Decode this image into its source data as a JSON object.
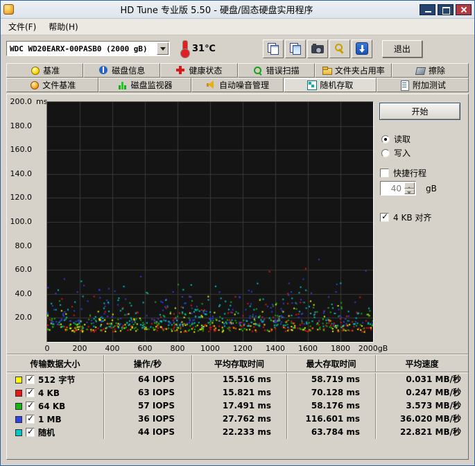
{
  "window": {
    "title": "HD Tune 专业版 5.50 - 硬盘/固态硬盘实用程序"
  },
  "menu": {
    "items": [
      "文件(F)",
      "帮助(H)"
    ]
  },
  "toolbar": {
    "drive": "WDC WD20EARX-00PASB0 (2000 gB)",
    "temperature": "31℃",
    "exit_label": "退出"
  },
  "tabs": {
    "row1": [
      "基准",
      "磁盘信息",
      "健康状态",
      "错误扫描",
      "文件夹占用率",
      "擦除"
    ],
    "row2": [
      "文件基准",
      "磁盘监视器",
      "自动噪音管理",
      "随机存取",
      "附加测试"
    ],
    "active_row": 2,
    "active_index": 3,
    "active_label": "随机存取"
  },
  "controls": {
    "start_label": "开始",
    "read_label": "读取",
    "write_label": "写入",
    "read_selected": true,
    "write_selected": false,
    "short_stroke_label": "快捷行程",
    "short_stroke_checked": false,
    "short_stroke_value": "40",
    "short_stroke_unit": "gB",
    "align_label": "4 KB 对齐",
    "align_checked": true
  },
  "chart_data": {
    "type": "scatter",
    "ylabel_unit": "ms",
    "ylim": [
      0,
      200
    ],
    "xlim_gb": [
      0,
      2000
    ],
    "grid": true,
    "background": "#141414",
    "grid_color": "#3a3a3a",
    "yticks": [
      "200.0",
      "180.0",
      "160.0",
      "140.0",
      "120.0",
      "100.0",
      "80.0",
      "60.0",
      "40.0",
      "20.0"
    ],
    "xticks": [
      "0",
      "200",
      "400",
      "600",
      "800",
      "1000",
      "1200",
      "1400",
      "1600",
      "1800",
      "2000gB"
    ],
    "series": [
      {
        "name": "512 字节",
        "color": "#ffff00",
        "iops": 64,
        "avg_access_ms": 15.516,
        "max_access_ms": 58.719,
        "avg_speed_mb_s": 0.031
      },
      {
        "name": "4 KB",
        "color": "#ee1414",
        "iops": 63,
        "avg_access_ms": 15.821,
        "max_access_ms": 70.128,
        "avg_speed_mb_s": 0.247
      },
      {
        "name": "64 KB",
        "color": "#14b414",
        "iops": 57,
        "avg_access_ms": 17.491,
        "max_access_ms": 58.176,
        "avg_speed_mb_s": 3.573
      },
      {
        "name": "1 MB",
        "color": "#2d42e8",
        "iops": 36,
        "avg_access_ms": 27.762,
        "max_access_ms": 116.601,
        "avg_speed_mb_s": 36.02
      },
      {
        "name": "随机",
        "color": "#00c8c8",
        "iops": 44,
        "avg_access_ms": 22.233,
        "max_access_ms": 63.784,
        "avg_speed_mb_s": 22.821
      }
    ]
  },
  "table": {
    "headers": [
      "传输数据大小",
      "操作/秒",
      "平均存取时间",
      "最大存取时间",
      "平均速度"
    ],
    "rows": [
      {
        "label": "512 字节",
        "color": "#ffff00",
        "checked": true,
        "iops": "64 IOPS",
        "avg_access": "15.516 ms",
        "max_access": "58.719 ms",
        "avg_speed": "0.031 MB/秒"
      },
      {
        "label": "4 KB",
        "color": "#ee1414",
        "checked": true,
        "iops": "63 IOPS",
        "avg_access": "15.821 ms",
        "max_access": "70.128 ms",
        "avg_speed": "0.247 MB/秒"
      },
      {
        "label": "64 KB",
        "color": "#14b414",
        "checked": true,
        "iops": "57 IOPS",
        "avg_access": "17.491 ms",
        "max_access": "58.176 ms",
        "avg_speed": "3.573 MB/秒"
      },
      {
        "label": "1 MB",
        "color": "#2d42e8",
        "checked": true,
        "iops": "36 IOPS",
        "avg_access": "27.762 ms",
        "max_access": "116.601 ms",
        "avg_speed": "36.020 MB/秒"
      },
      {
        "label": "随机",
        "color": "#00c8c8",
        "checked": true,
        "iops": "44 IOPS",
        "avg_access": "22.233 ms",
        "max_access": "63.784 ms",
        "avg_speed": "22.821 MB/秒"
      }
    ]
  }
}
